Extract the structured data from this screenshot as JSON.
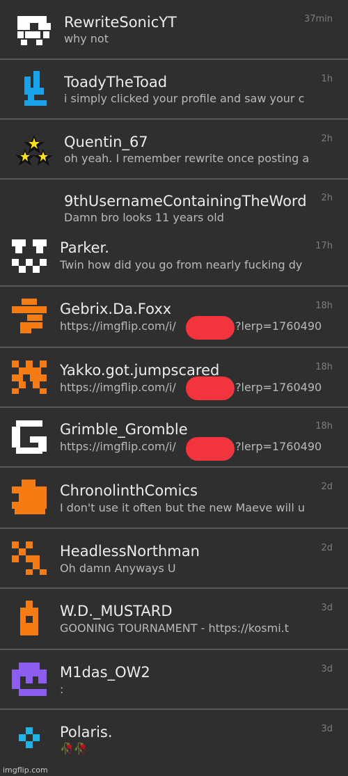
{
  "conversations": [
    {
      "name": "RewriteSonicYT",
      "message": "why not",
      "time": "37min",
      "avatar": "white-pixel-avatar-icon",
      "color": "#ffffff"
    },
    {
      "name": "ToadyTheToad",
      "message": "i simply clicked your profile and saw your c",
      "time": "1h",
      "avatar": "blue-pixel-avatar-icon",
      "color": "#1aa3e8"
    },
    {
      "name": "Quentin_67",
      "message": "oh yeah. I remember rewrite once posting a",
      "time": "2h",
      "avatar": "stars-avatar-icon",
      "color": "#f7e11a"
    },
    {
      "name": "9thUsernameContainingTheWord",
      "message": "Damn bro looks 11 years old",
      "time": "2h",
      "avatar": "blank-avatar",
      "color": "#2f2f2f"
    },
    {
      "name": "Parker.",
      "message": "Twin how did you go from nearly fucking dy",
      "time": "17h",
      "avatar": "white-pixel-avatar-icon",
      "color": "#ffffff"
    },
    {
      "name": "Gebrix.Da.Foxx",
      "message": "https://imgflip.com/i/",
      "message_tail": "?lerp=1760490",
      "time": "18h",
      "avatar": "orange-pixel-avatar-icon",
      "color": "#f47c13"
    },
    {
      "name": "Yakko.got.jumpscared",
      "message": "https://imgflip.com/i/",
      "message_tail": "?lerp=1760490",
      "time": "18h",
      "avatar": "orange-pixel-avatar-icon",
      "color": "#f47c13"
    },
    {
      "name": "Grimble_Gromble",
      "message": "https://imgflip.com/i/",
      "message_tail": "?lerp=1760490",
      "time": "18h",
      "avatar": "letter-g-avatar-icon",
      "color": "#ffffff"
    },
    {
      "name": "ChronolinthComics",
      "message": "I don't use it often but the new Maeve will u",
      "time": "2d",
      "avatar": "orange-pixel-avatar-icon",
      "color": "#f47c13"
    },
    {
      "name": "HeadlessNorthman",
      "message": "Oh damn Anyways U",
      "time": "2d",
      "avatar": "orange-pixel-avatar-icon",
      "color": "#f47c13"
    },
    {
      "name": "W.D._MUSTARD",
      "message": "GOONING TOURNAMENT - https://kosmi.t",
      "time": "3d",
      "avatar": "orange-bottle-avatar-icon",
      "color": "#f47c13"
    },
    {
      "name": "M1das_OW2",
      "message": ":",
      "time": "3d",
      "avatar": "purple-pixel-avatar-icon",
      "color": "#8d5df0"
    },
    {
      "name": "Polaris.",
      "message": "🥀🥀",
      "time": "3d",
      "avatar": "cyan-diamond-avatar-icon",
      "color": "#1fb3e6"
    }
  ],
  "watermark": "imgflip.com"
}
